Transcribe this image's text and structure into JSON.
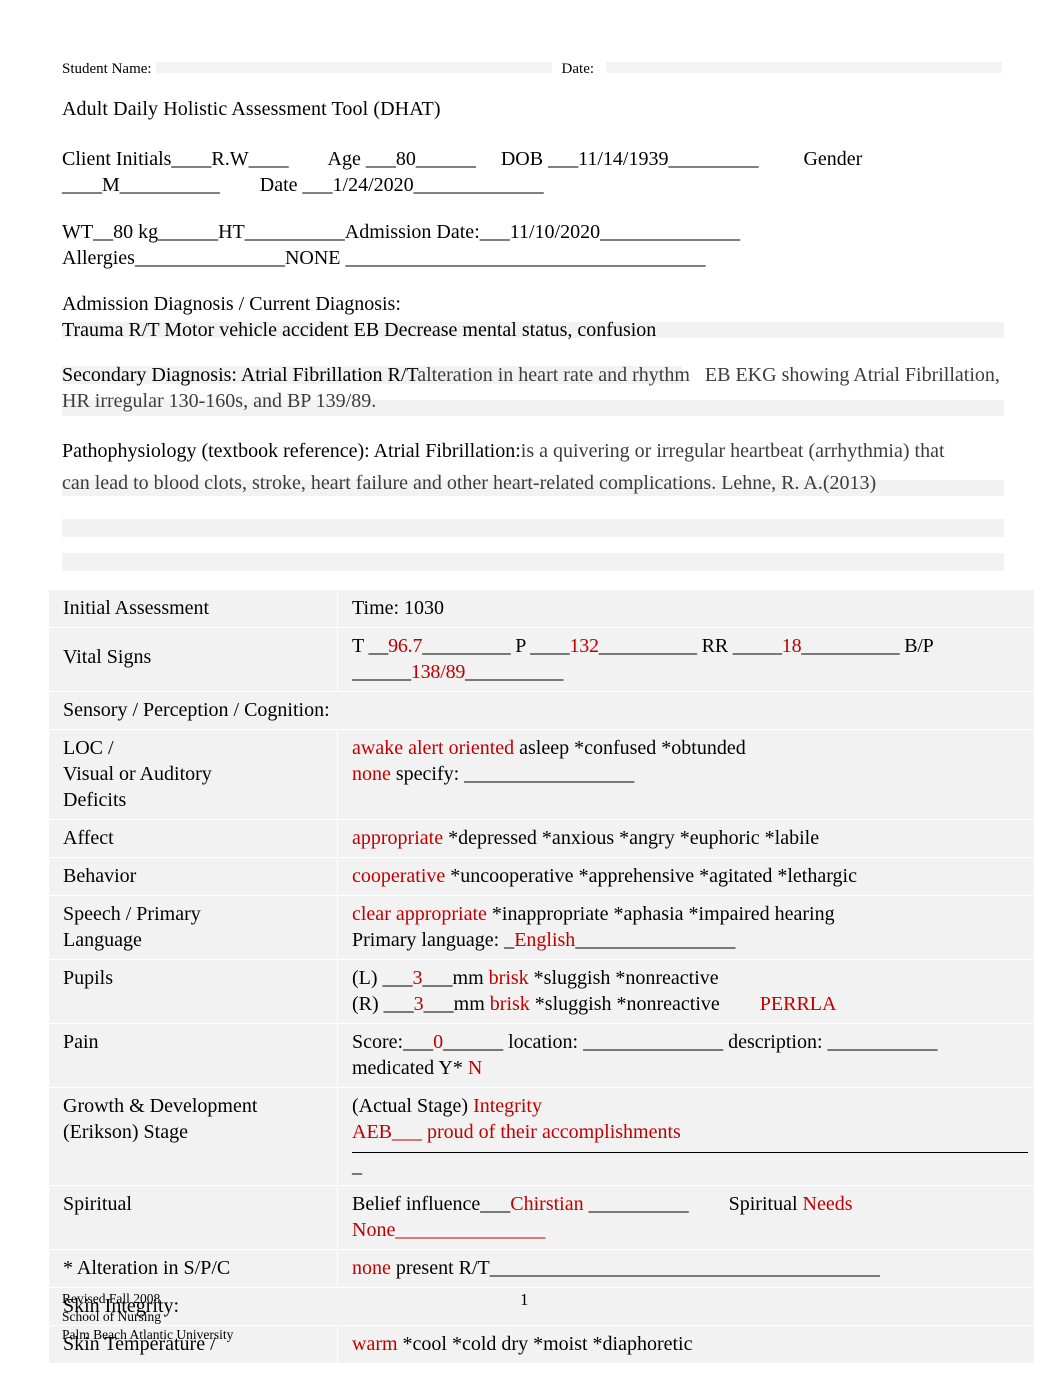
{
  "colors": {
    "accent_red": "#C00000",
    "shade": "#f2f2f2",
    "text": "#000000"
  },
  "header": {
    "student_name_label": "Student Name:",
    "date_label": "Date:",
    "doc_title": "Adult Daily Holistic Assessment Tool (DHAT)"
  },
  "intake": {
    "line1": "Client Initials____R.W____        Age ___80______     DOB ___11/14/1939_________         Gender",
    "line2": "____M__________        Date ___1/24/2020_____________",
    "line3": "WT__80 kg______HT__________Admission Date:___11/10/2020______________",
    "line4": "Allergies_______________NONE ____________________________________",
    "admission_dx_label": "Admission Diagnosis / Current Diagnosis:",
    "admission_dx_value": "Trauma R/T Motor vehicle accident EB Decrease mental status, confusion",
    "secondary_dx_label": "Secondary Diagnosis: Atrial Fibrillation R/T",
    "secondary_dx_mid": "alteration in heart rate and rhythm",
    "secondary_dx_eb": "EB EKG showing Atrial Fibrillation, HR irregular 130-160s, and BP 139/89.",
    "patho_label": "Pathophysiology (textbook reference): Atrial Fibrillation:",
    "patho_text1": "is a quivering or irregular heartbeat (arrhythmia) that",
    "patho_text2": "can lead to blood clots, stroke, heart failure and other heart-related complications. Lehne, R. A.(2013)"
  },
  "assessment": {
    "initial_label": "Initial Assessment",
    "time_value": "Time: 1030",
    "vitals_label": "Vital Signs",
    "vitals": {
      "t_label": "T  __",
      "t_value": "96.7",
      "t_tail": "_________",
      "p_label": "  P  ____",
      "p_value": "132",
      "p_tail": "__________",
      "rr_label": "  RR  _____",
      "rr_value": "18",
      "rr_tail": "__________",
      "bp_label": "  B/P  ______",
      "bp_value": "138/89",
      "bp_tail": "__________"
    },
    "sensory_header": "Sensory / Perception / Cognition:",
    "loc_label_l1": "LOC  /",
    "loc_label_l2": "Visual or Auditory",
    "loc_label_l3": "Deficits",
    "loc_opts_red": "awake  alert  oriented",
    "loc_opts_black": " asleep   *confused  *obtunded",
    "deficits_red": "none",
    "deficits_black": " specify: _________________",
    "affect_label": "Affect",
    "affect_red": " appropriate",
    "affect_black": "  *depressed   *anxious   *angry   *euphoric   *labile",
    "behavior_label": "Behavior",
    "behavior_red": " cooperative",
    "behavior_black": "  *uncooperative  *apprehensive  *agitated   *lethargic",
    "speech_label_l1": "Speech / Primary",
    "speech_label_l2": "Language",
    "speech_red": "clear   appropriate",
    "speech_black": "   *inappropriate   *aphasia   *impaired hearing",
    "primary_lang_label": "Primary language: _",
    "primary_lang_value": "English",
    "primary_lang_tail": "________________",
    "pupils_label": "Pupils",
    "pupil_l_pre": "(L)  ___",
    "pupil_l_val": "3",
    "pupil_l_mid": "___mm  ",
    "pupil_l_brisk": "brisk",
    "pupil_l_post": "  *sluggish  *nonreactive",
    "pupil_r_pre": "(R) ___",
    "pupil_r_val": "3",
    "pupil_r_mid": "___mm  ",
    "pupil_r_brisk": "brisk",
    "pupil_r_post": "  *sluggish  *nonreactive",
    "perrla": "PERRLA",
    "pain_label": "Pain",
    "pain_score_pre": "Score:___",
    "pain_score_val": "0",
    "pain_score_tail": "______",
    "pain_location": "     location: ______________",
    "pain_description": "  description: ___________",
    "pain_medicated_label": "medicated Y*   ",
    "pain_medicated_val": "N",
    "growth_label_l1": "Growth & Development",
    "growth_label_l2": "(Erikson) Stage",
    "growth_stage_label": "(Actual Stage) ",
    "growth_stage_value": "Integrity",
    "growth_aeb": "AEB___  proud of their accomplishments",
    "growth_dash": "_",
    "spiritual_label": "Spiritual",
    "spiritual_belief_label": "Belief influence___",
    "spiritual_belief_value": "Chirstian",
    "spiritual_belief_tail": " __________",
    "spiritual_needs_label": "        Spiritual ",
    "spiritual_needs_value": "Needs",
    "spiritual_needs_value2": "None_______________",
    "alteration_label": "* Alteration in S/P/C",
    "alteration_red": "none",
    "alteration_black": "   present R/T_______________________________________",
    "skin_header": "Skin Integrity:",
    "skin_temp_label": "Skin Temperature /",
    "skin_temp_red": "warm",
    "skin_temp_black": "  *cool  *cold  dry  *moist  *diaphoretic"
  },
  "footer": {
    "line1": "Revised Fall 2008",
    "line2": "School of Nursing",
    "line3": "Palm Beach Atlantic University",
    "page_number": "1"
  }
}
